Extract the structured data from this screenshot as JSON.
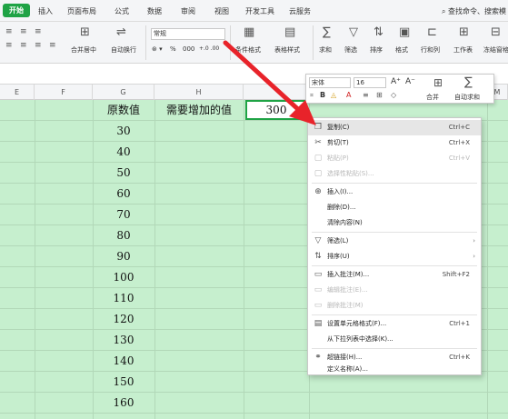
{
  "tabs": {
    "home": "开始",
    "insert": "插入",
    "page_layout": "页面布局",
    "formulas": "公式",
    "data": "数据",
    "review": "审阅",
    "view": "视图",
    "developer": "开发工具",
    "cloud": "云服务",
    "search_hint": "查找命令、搜索模"
  },
  "ribbon": {
    "merge_center": "合并居中",
    "wrap_text": "自动换行",
    "number_format": "常规",
    "percent": "%",
    "thousands": "000",
    "dec_inc": "+.0 .00",
    "dec_dec": ".00 +.0",
    "cond_format": "条件格式",
    "table_style": "表格样式",
    "sum": "求和",
    "filter": "筛选",
    "sort": "排序",
    "format": "格式",
    "row_col": "行和列",
    "worksheet": "工作表",
    "freeze": "冻结窗格"
  },
  "columns": [
    "E",
    "F",
    "G",
    "H",
    "I",
    "M"
  ],
  "cells": {
    "g_header": "原数值",
    "h_header": "需要增加的值",
    "i_value": "300",
    "g_values": [
      "30",
      "40",
      "50",
      "60",
      "70",
      "80",
      "90",
      "100",
      "110",
      "120",
      "130",
      "140",
      "150",
      "160"
    ]
  },
  "mini_toolbar": {
    "font_name": "宋体",
    "font_size": "16",
    "grow_font": "A⁺",
    "shrink_font": "A⁻",
    "bold": "B",
    "merge": "合并",
    "autosum": "自动求和"
  },
  "context_menu": {
    "items": [
      {
        "label": "复制(C)",
        "shortcut": "Ctrl+C"
      },
      {
        "label": "剪切(T)",
        "shortcut": "Ctrl+X"
      },
      {
        "label": "粘贴(P)",
        "shortcut": "Ctrl+V"
      },
      {
        "label": "选择性粘贴(S)...",
        "shortcut": ""
      },
      {
        "label": "插入(I)...",
        "shortcut": ""
      },
      {
        "label": "删除(D)...",
        "shortcut": ""
      },
      {
        "label": "清除内容(N)",
        "shortcut": ""
      },
      {
        "label": "筛选(L)",
        "shortcut": ""
      },
      {
        "label": "排序(U)",
        "shortcut": ""
      },
      {
        "label": "插入批注(M)...",
        "shortcut": "Shift+F2"
      },
      {
        "label": "编辑批注(E)...",
        "shortcut": ""
      },
      {
        "label": "删除批注(M)",
        "shortcut": ""
      },
      {
        "label": "设置单元格格式(F)...",
        "shortcut": "Ctrl+1"
      },
      {
        "label": "从下拉列表中选择(K)...",
        "shortcut": ""
      },
      {
        "label": "超链接(H)...",
        "shortcut": "Ctrl+K"
      },
      {
        "label": "定义名称(A)...",
        "shortcut": ""
      }
    ]
  },
  "colors": {
    "accent_green": "#1fa345",
    "grid_fill": "#c6efce",
    "arrow_red": "#e8232a"
  }
}
